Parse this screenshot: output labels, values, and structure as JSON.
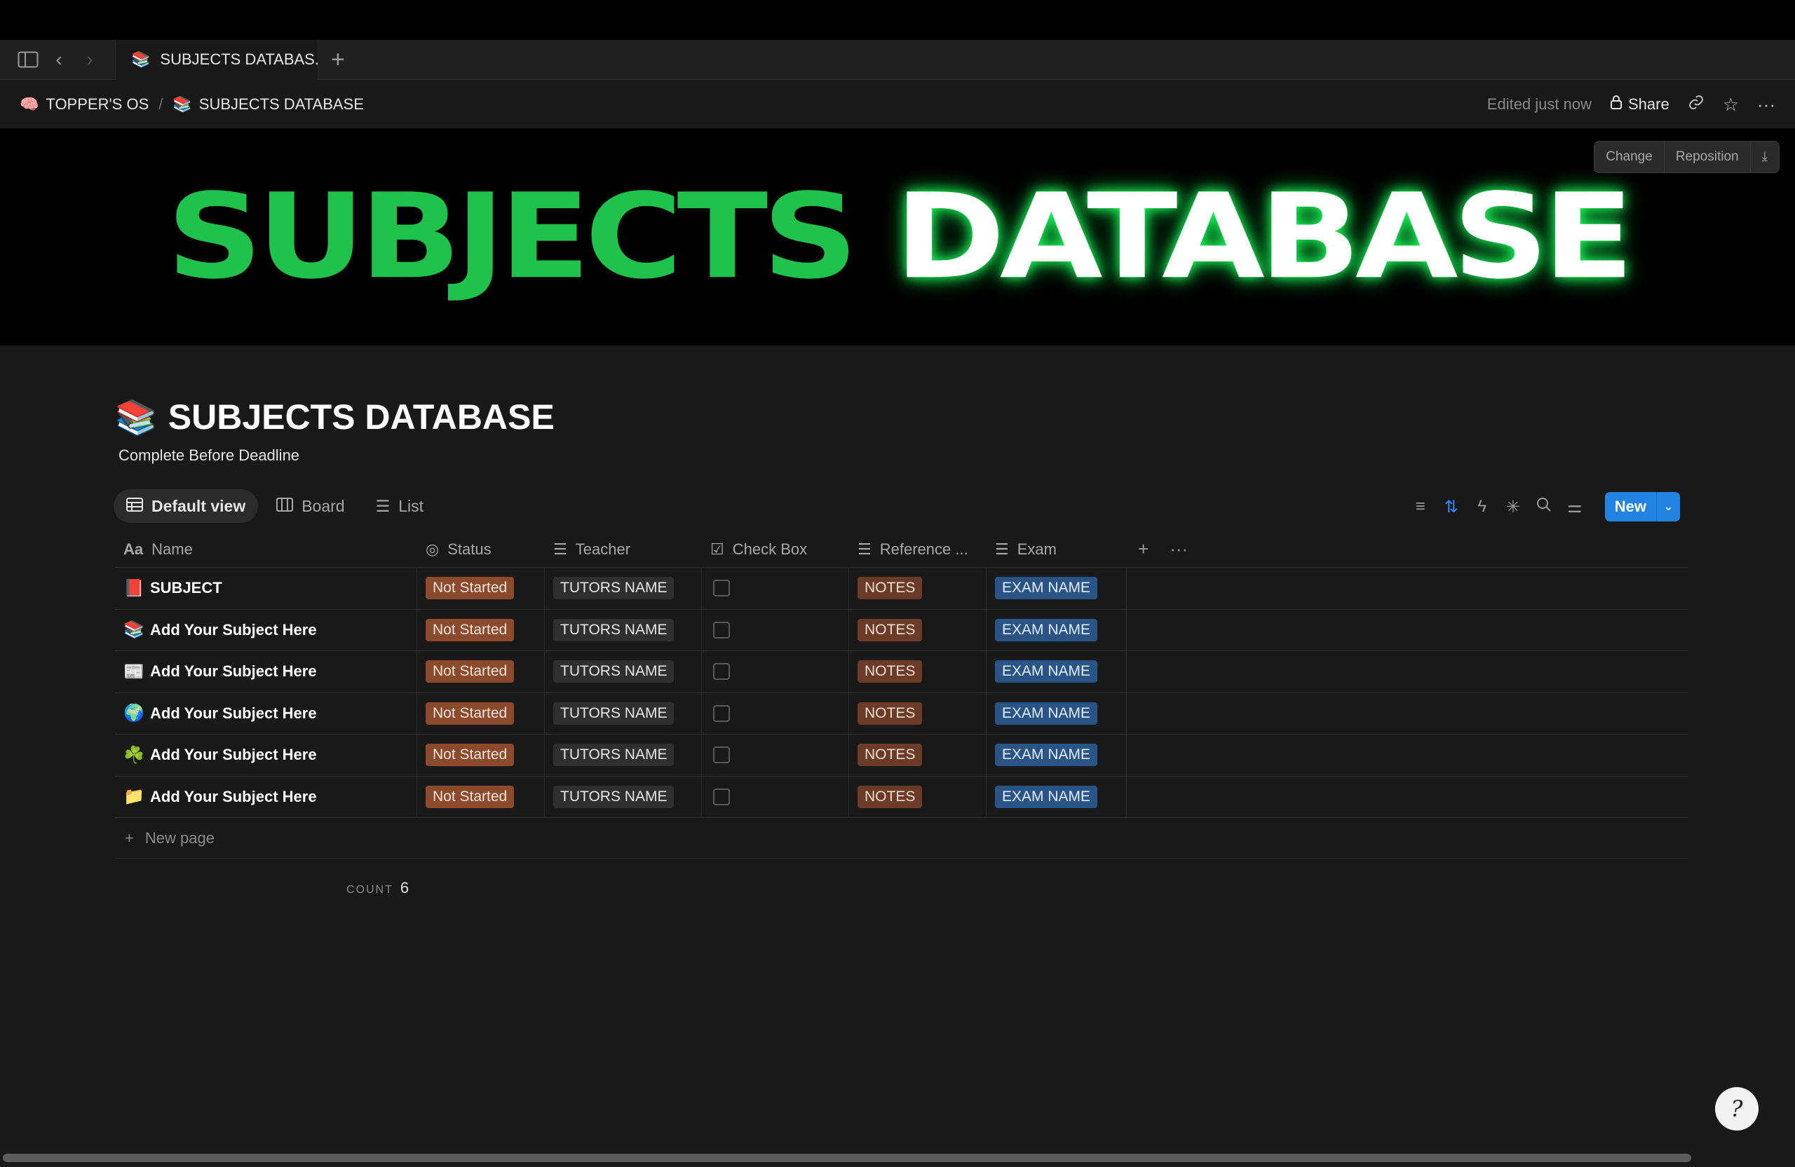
{
  "browser": {
    "tab_title": "SUBJECTS DATABAS...",
    "tab_emoji": "📚"
  },
  "breadcrumb": {
    "items": [
      {
        "emoji": "🧠",
        "label": "TOPPER'S OS"
      },
      {
        "emoji": "📚",
        "label": "SUBJECTS DATABASE"
      }
    ],
    "separator": "/",
    "edited": "Edited just now",
    "share_label": "Share"
  },
  "cover": {
    "text_green": "SUBJECTS",
    "text_white": "DATABASE",
    "change_label": "Change",
    "reposition_label": "Reposition"
  },
  "page": {
    "emoji": "📚",
    "title": "SUBJECTS DATABASE",
    "subtitle": "Complete Before Deadline"
  },
  "views": [
    {
      "label": "Default view",
      "icon": "table-icon",
      "active": true
    },
    {
      "label": "Board",
      "icon": "board-icon",
      "active": false
    },
    {
      "label": "List",
      "icon": "list-icon",
      "active": false
    }
  ],
  "toolbar": {
    "new_label": "New"
  },
  "columns": {
    "name": {
      "icon": "Aa",
      "label": "Name"
    },
    "status": {
      "label": "Status"
    },
    "teacher": {
      "label": "Teacher"
    },
    "check": {
      "label": "Check Box"
    },
    "reference": {
      "label": "Reference ..."
    },
    "exam": {
      "label": "Exam"
    }
  },
  "rows": [
    {
      "emoji": "📕",
      "name": "SUBJECT",
      "status": "Not Started",
      "teacher": "TUTORS NAME",
      "checked": false,
      "reference": "NOTES",
      "exam": "EXAM NAME"
    },
    {
      "emoji": "📚",
      "name": "Add Your Subject Here",
      "status": "Not Started",
      "teacher": "TUTORS NAME",
      "checked": false,
      "reference": "NOTES",
      "exam": "EXAM NAME"
    },
    {
      "emoji": "📰",
      "name": "Add Your Subject Here",
      "status": "Not Started",
      "teacher": "TUTORS NAME",
      "checked": false,
      "reference": "NOTES",
      "exam": "EXAM NAME"
    },
    {
      "emoji": "🌍",
      "name": "Add Your Subject Here",
      "status": "Not Started",
      "teacher": "TUTORS NAME",
      "checked": false,
      "reference": "NOTES",
      "exam": "EXAM NAME"
    },
    {
      "emoji": "☘️",
      "name": "Add Your Subject Here",
      "status": "Not Started",
      "teacher": "TUTORS NAME",
      "checked": false,
      "reference": "NOTES",
      "exam": "EXAM NAME"
    },
    {
      "emoji": "📁",
      "name": "Add Your Subject Here",
      "status": "Not Started",
      "teacher": "TUTORS NAME",
      "checked": false,
      "reference": "NOTES",
      "exam": "EXAM NAME"
    }
  ],
  "new_page_label": "New page",
  "count": {
    "label": "COUNT",
    "value": "6"
  },
  "colors": {
    "accent": "#2383e2",
    "status_tag": "#8a4a2b",
    "reference_tag": "#6b3b27",
    "exam_tag": "#2a5486",
    "cover_green": "#1fc24a"
  }
}
